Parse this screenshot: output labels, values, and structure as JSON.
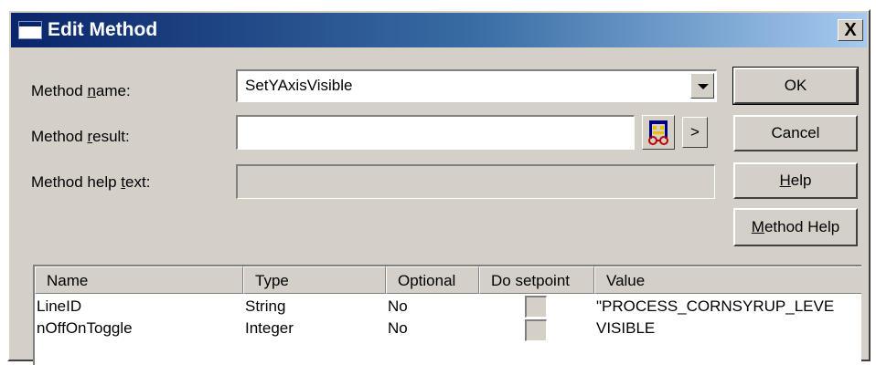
{
  "window": {
    "title": "Edit Method",
    "close_symbol": "X"
  },
  "form": {
    "method_name": {
      "label_pre": "Method ",
      "label_key": "n",
      "label_post": "ame:",
      "value": "SetYAxisVisible"
    },
    "method_result": {
      "label_pre": "Method ",
      "label_key": "r",
      "label_post": "esult:",
      "value": ""
    },
    "method_help_text": {
      "label_pre": "Method help ",
      "label_key": "t",
      "label_post": "ext:",
      "value": ""
    },
    "arrow_button_label": ">"
  },
  "buttons": {
    "ok": "OK",
    "cancel": "Cancel",
    "help_key": "H",
    "help_rest": "elp",
    "method_help_key": "M",
    "method_help_rest": "ethod Help"
  },
  "parameters": {
    "columns": [
      "Name",
      "Type",
      "Optional",
      "Do setpoint",
      "Value"
    ],
    "rows": [
      {
        "name": "LineID",
        "type": "String",
        "optional": "No",
        "do_setpoint": false,
        "value": "\"PROCESS_CORNSYRUP_LEVE"
      },
      {
        "name": "nOffOnToggle",
        "type": "Integer",
        "optional": "No",
        "do_setpoint": false,
        "value": "VISIBLE"
      }
    ]
  },
  "icons": {
    "browse": "tag-browser-icon",
    "dropdown": "chevron-down-icon"
  }
}
